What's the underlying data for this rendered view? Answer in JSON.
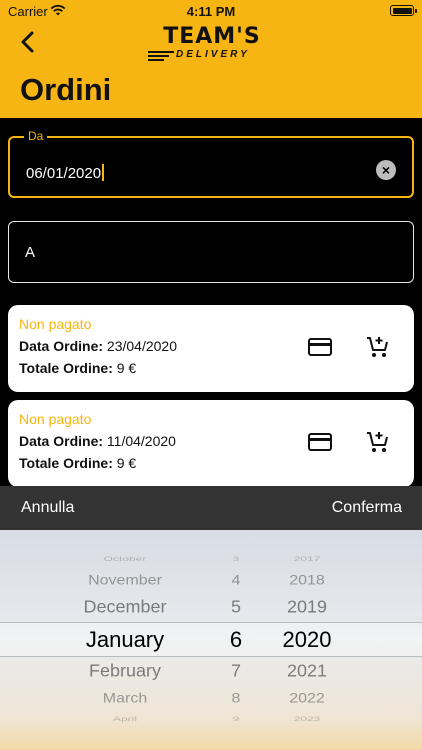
{
  "status_bar": {
    "carrier": "Carrier",
    "time": "4:11 PM"
  },
  "header": {
    "logo_main": "TEAM'S",
    "logo_sub": "DELIVERY",
    "title": "Ordini",
    "accent_color": "#F7B513"
  },
  "filters": {
    "from": {
      "label": "Da",
      "value": "06/01/2020"
    },
    "to": {
      "placeholder": "A"
    }
  },
  "orders": [
    {
      "status": "Non pagato",
      "date_label": "Data Ordine:",
      "date": "23/04/2020",
      "total_label": "Totale Ordine:",
      "total": "9 €"
    },
    {
      "status": "Non pagato",
      "date_label": "Data Ordine:",
      "date": "11/04/2020",
      "total_label": "Totale Ordine:",
      "total": "9 €"
    }
  ],
  "picker": {
    "cancel_label": "Annulla",
    "confirm_label": "Conferma",
    "months": [
      "October",
      "November",
      "December",
      "January",
      "February",
      "March",
      "April"
    ],
    "days": [
      "3",
      "4",
      "5",
      "6",
      "7",
      "8",
      "9"
    ],
    "years": [
      "2017",
      "2018",
      "2019",
      "2020",
      "2021",
      "2022",
      "2023"
    ],
    "selected": {
      "month": "January",
      "day": "6",
      "year": "2020"
    }
  },
  "icons": {
    "back": "chevron-left-icon",
    "wifi": "wifi-icon",
    "battery": "battery-icon",
    "clear": "clear-icon",
    "payment": "credit-card-icon",
    "cart": "add-to-cart-icon"
  }
}
